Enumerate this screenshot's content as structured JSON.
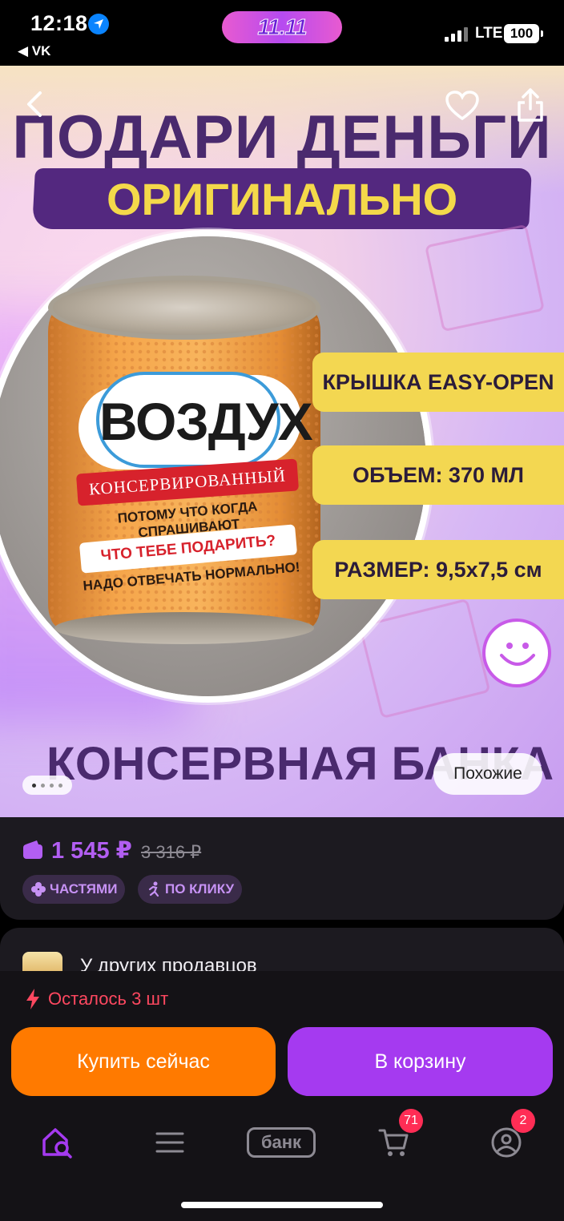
{
  "status_bar": {
    "time": "12:18",
    "back_app": "◀ VK",
    "promo_label": "11.11",
    "network": "LTE",
    "battery": "100"
  },
  "banner": {
    "title": "ПОДАРИ ДЕНЬГИ",
    "subtitle": "ОРИГИНАЛЬНО",
    "can": {
      "name": "ВОЗДУХ",
      "ribbon": "КОНСЕРВИРОВАННЫЙ",
      "line1": "ПОТОМУ ЧТО КОГДА СПРАШИВАЮТ",
      "highlight": "ЧТО ТЕБЕ ПОДАРИТЬ?",
      "line2": "НАДО ОТВЕЧАТЬ НОРМАЛЬНО!"
    },
    "features": [
      "КРЫШКА EASY-OPEN",
      "ОБЪЕМ: 370 МЛ",
      "РАЗМЕР: 9,5х7,5 см"
    ],
    "bottom_text": "КОНСЕРВНАЯ БАНКА",
    "similar_label": "Похожие",
    "slide_current": 1,
    "slide_count": 4
  },
  "price": {
    "current": "1 545 ₽",
    "old": "3 316 ₽",
    "chips": [
      "ЧАСТЯМИ",
      "ПО КЛИКУ"
    ]
  },
  "other_sellers": {
    "title": "У других продавцов"
  },
  "stock": {
    "text": "Осталось 3 шт"
  },
  "actions": {
    "buy_now": "Купить сейчас",
    "add_to_cart": "В корзину"
  },
  "tabbar": {
    "bank_label": "банк",
    "cart_badge": "71",
    "profile_badge": "2"
  },
  "colors": {
    "accent": "#a53af0",
    "buy": "#ff7a00",
    "warning": "#ff4860",
    "price": "#b25ef2"
  }
}
